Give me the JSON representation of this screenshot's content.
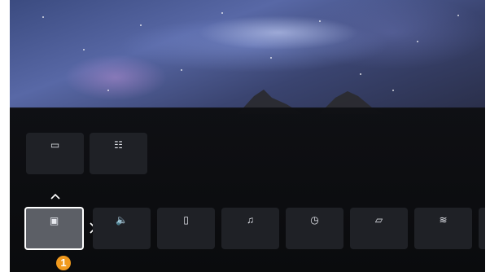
{
  "wallpaper": {
    "description_icon": "milky-way-wallpaper"
  },
  "sections": {
    "top": {
      "label": "",
      "tiles": [
        {
          "icon": "picture-frame-icon",
          "glyph": "▭",
          "label": ""
        },
        {
          "icon": "list-document-icon",
          "glyph": "☷",
          "label": ""
        }
      ]
    },
    "bottom": {
      "label": "",
      "tiles": [
        {
          "icon": "picture-mode-icon",
          "glyph": "▣",
          "label": ""
        },
        {
          "icon": "speaker-icon",
          "glyph": "🔈",
          "label": ""
        },
        {
          "icon": "audio-output-icon",
          "glyph": "▯",
          "label": ""
        },
        {
          "icon": "headphones-icon",
          "glyph": "♫",
          "label": ""
        },
        {
          "icon": "clock-icon",
          "glyph": "◷",
          "label": ""
        },
        {
          "icon": "screen-off-icon",
          "glyph": "▱",
          "label": ""
        },
        {
          "icon": "wifi-icon",
          "glyph": "≋",
          "label": ""
        }
      ]
    }
  },
  "callout": {
    "number": "1"
  },
  "colors": {
    "callout": "#f19a1e",
    "selected_border": "#ffffff",
    "tile_bg": "#1f2126"
  }
}
